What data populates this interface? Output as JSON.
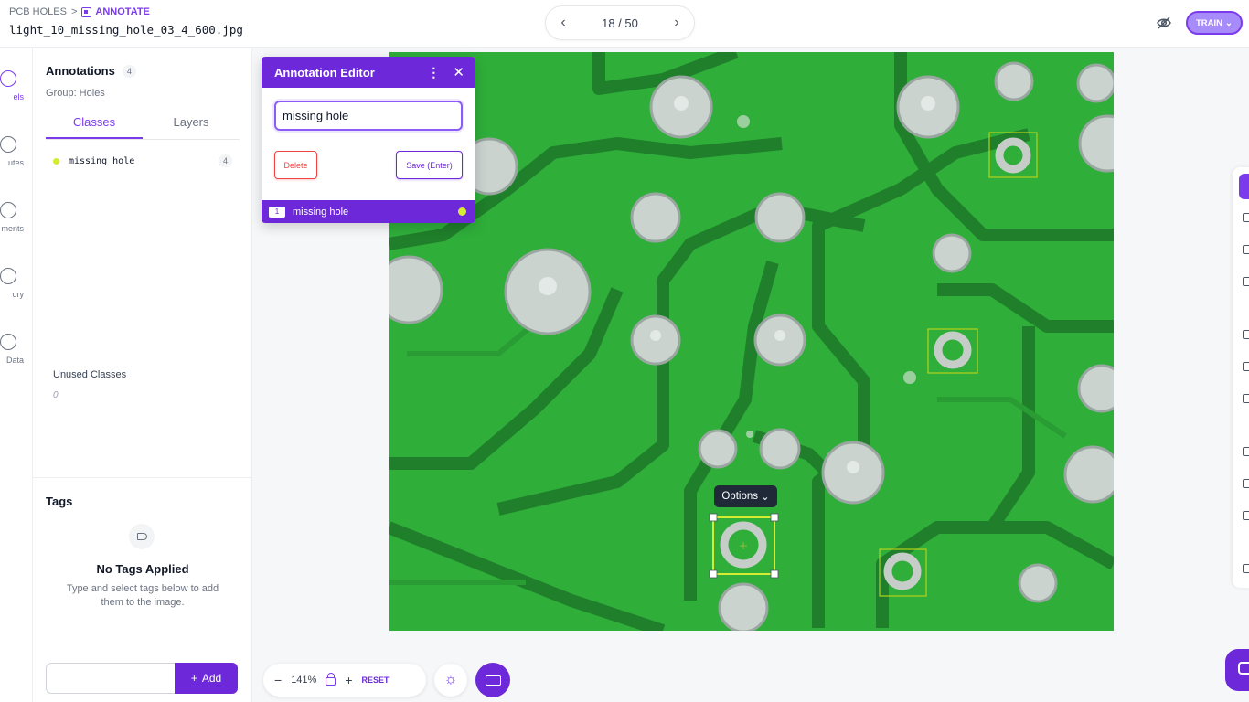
{
  "header": {
    "breadcrumb_project": "PCB HOLES",
    "breadcrumb_separator": ">",
    "breadcrumb_section": "ANNOTATE",
    "filename": "light_10_missing_hole_03_4_600.jpg",
    "pager_prev": "‹",
    "pager_next": "›",
    "pager_text": "18 / 50",
    "train_label": "TRAIN",
    "train_chevron": "⌄"
  },
  "rail": {
    "items": [
      {
        "label": "els",
        "icon": "labels-icon",
        "active": true
      },
      {
        "label": "utes",
        "icon": "attributes-icon"
      },
      {
        "label": "ments",
        "icon": "comments-icon"
      },
      {
        "label": "ory",
        "icon": "history-icon"
      },
      {
        "label": "Data",
        "icon": "raw-data-icon"
      }
    ]
  },
  "sidebar": {
    "title": "Annotations",
    "annotation_count": "4",
    "group": "Group: Holes",
    "tabs": [
      {
        "label": "Classes",
        "active": true
      },
      {
        "label": "Layers"
      }
    ],
    "classes": [
      {
        "name": "missing hole",
        "count": "4",
        "color": "#d4ed32"
      }
    ],
    "unused_title": "Unused Classes",
    "unused_count": "0",
    "tags_title": "Tags",
    "no_tags_title": "No Tags Applied",
    "no_tags_desc": "Type and select tags below to add them to the image.",
    "tag_input_value": "",
    "add_label": "Add",
    "add_icon": "+"
  },
  "editor": {
    "title": "Annotation Editor",
    "menu_icon": "⋮",
    "close_icon": "✕",
    "input_value": "missing hole",
    "delete_label": "Delete",
    "save_label": "Save (Enter)",
    "footer_key": "1",
    "footer_label": "missing hole",
    "footer_color": "#d4ed32"
  },
  "canvas": {
    "options_label": "Options",
    "options_chevron": "⌄"
  },
  "toolbar": {
    "zoom_out": "−",
    "zoom_level": "141%",
    "zoom_in": "+",
    "reset_label": "RESET",
    "brightness_icon": "☼"
  },
  "colors": {
    "accent": "#6d28d9",
    "accent_light": "#a78bfa",
    "board_green": "#2fae3a",
    "trace_gap": "#1f7f2a",
    "annotation_class": "#d4ed32"
  }
}
